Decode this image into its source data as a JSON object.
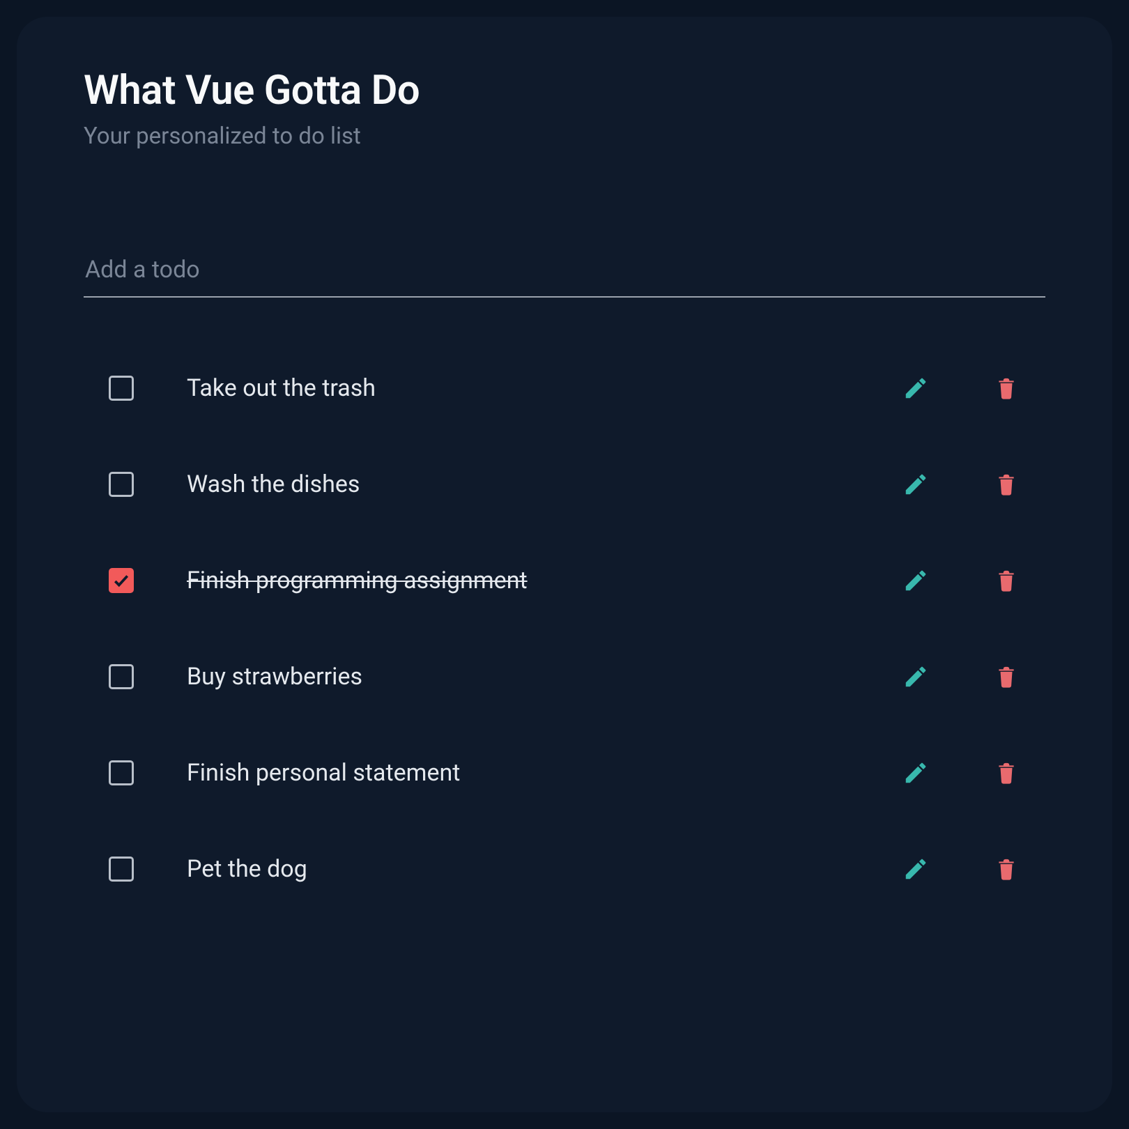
{
  "header": {
    "title": "What Vue Gotta Do",
    "subtitle": "Your personalized to do list"
  },
  "add_input": {
    "placeholder": "Add a todo",
    "value": ""
  },
  "icons": {
    "edit": "pencil-icon",
    "delete": "trash-icon",
    "check": "check-icon"
  },
  "colors": {
    "accent_edit": "#38b8ad",
    "accent_delete": "#e96a6e",
    "accent_checked": "#f25a5a"
  },
  "todos": [
    {
      "label": "Take out the trash",
      "done": false
    },
    {
      "label": "Wash the dishes",
      "done": false
    },
    {
      "label": "Finish programming assignment",
      "done": true
    },
    {
      "label": "Buy strawberries",
      "done": false
    },
    {
      "label": "Finish personal statement",
      "done": false
    },
    {
      "label": "Pet the dog",
      "done": false
    }
  ]
}
